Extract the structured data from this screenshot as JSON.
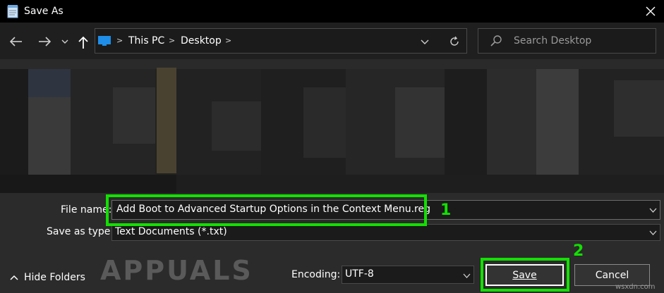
{
  "window": {
    "title": "Save As",
    "icon": "notepad-icon"
  },
  "nav": {
    "back_icon": "arrow-left-icon",
    "forward_icon": "arrow-right-icon",
    "recent_icon": "chevron-down-icon",
    "up_icon": "arrow-up-icon",
    "breadcrumb": [
      "This PC",
      "Desktop"
    ],
    "refresh_icon": "refresh-icon",
    "search_placeholder": "Search Desktop"
  },
  "form": {
    "filename_label": "File name:",
    "filename_value": "Add Boot to Advanced Startup Options in the Context Menu.reg",
    "type_label": "Save as type:",
    "type_value": "Text Documents (*.txt)",
    "hide_folders_label": "Hide Folders",
    "encoding_label": "Encoding:",
    "encoding_value": "UTF-8",
    "save_label": "Save",
    "cancel_label": "Cancel"
  },
  "annotations": {
    "step1": "1",
    "step2": "2",
    "highlight_color": "#12e000"
  },
  "watermark": "APPUALS",
  "site": "wsxdn.com"
}
